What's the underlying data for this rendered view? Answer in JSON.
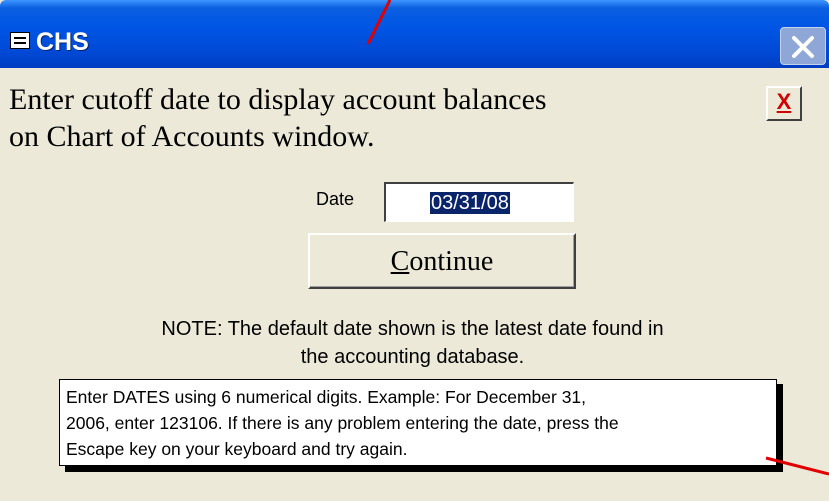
{
  "window": {
    "title": "CHS"
  },
  "form": {
    "heading_line1": "Enter cutoff date to display account balances",
    "heading_line2": "on Chart of Accounts window.",
    "close_label": "X",
    "date_label": "Date",
    "date_value": "03/31/08",
    "continue_accel": "C",
    "continue_rest": "ontinue",
    "note_line1": "NOTE:  The default date shown is the latest date found in",
    "note_line2": "the accounting database.",
    "info_line1": "Enter DATES using 6 numerical digits.  Example:  For December 31,",
    "info_line2": "2006, enter 123106.  If there is any problem entering the date, press the",
    "info_line3": "Escape key on your keyboard and try again."
  },
  "colors": {
    "titlebar": "#0055e5",
    "selection": "#0a246a",
    "close_x": "#d00000",
    "annotation_arrow": "#e00000"
  }
}
